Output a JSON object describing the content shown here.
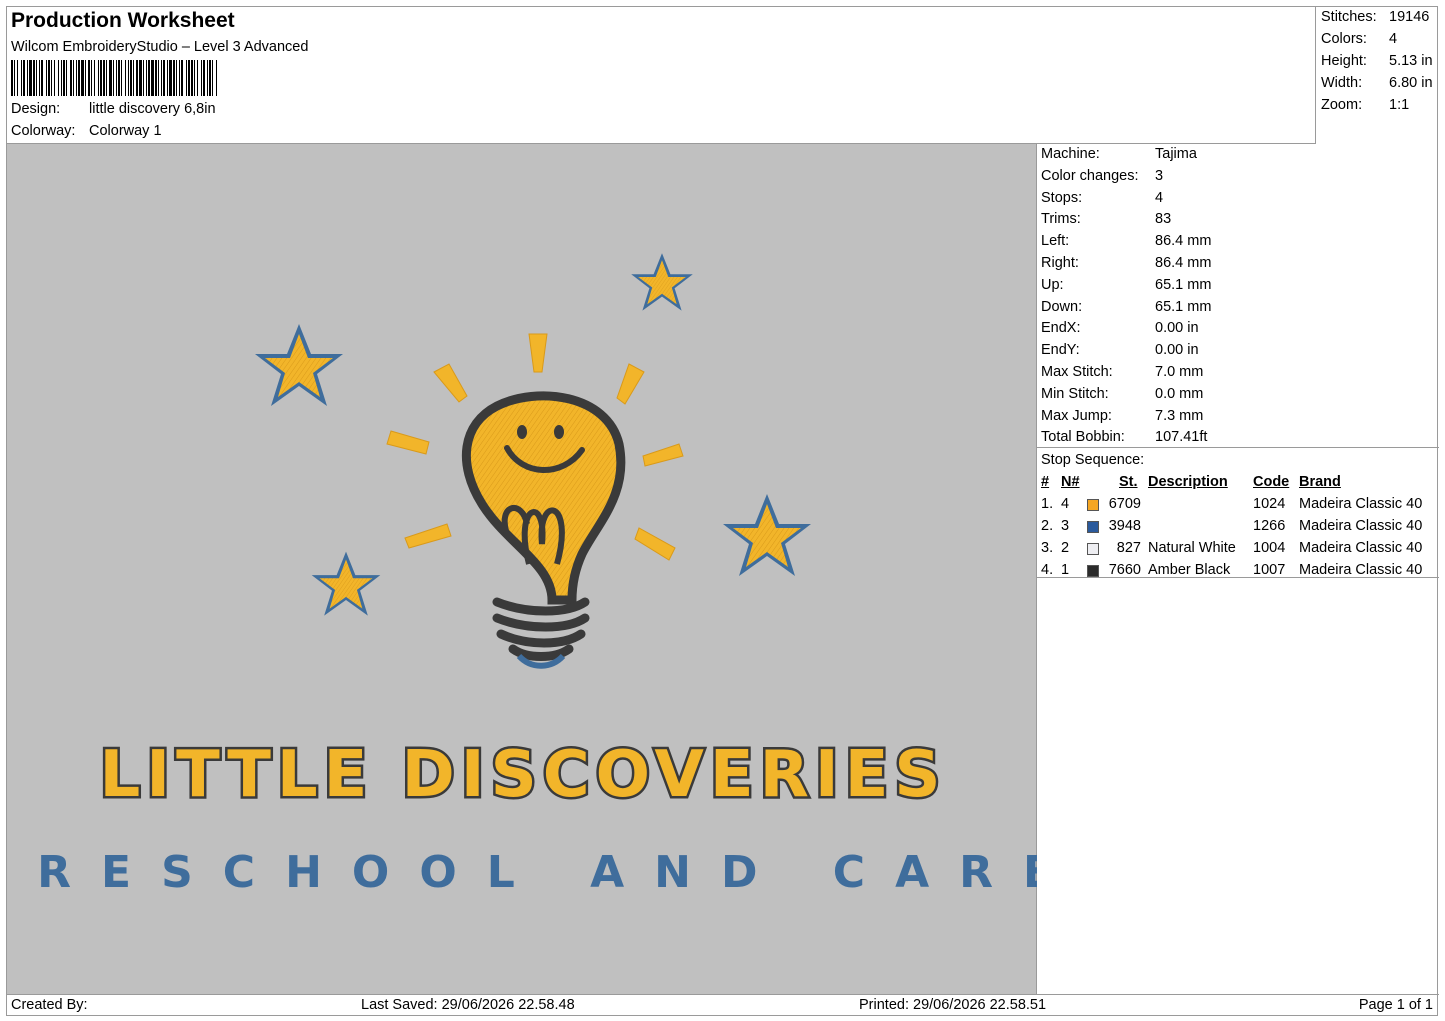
{
  "header": {
    "title": "Production Worksheet",
    "software": "Wilcom EmbroideryStudio – Level 3 Advanced",
    "design_label": "Design:",
    "design_value": "little discovery 6,8in",
    "colorway_label": "Colorway:",
    "colorway_value": "Colorway 1"
  },
  "stats": [
    {
      "label": "Stitches:",
      "value": "19146"
    },
    {
      "label": "Colors:",
      "value": "4"
    },
    {
      "label": "Height:",
      "value": "5.13 in"
    },
    {
      "label": "Width:",
      "value": "6.80 in"
    },
    {
      "label": "Zoom:",
      "value": "1:1"
    }
  ],
  "machine_info": [
    {
      "label": "Machine:",
      "value": "Tajima"
    },
    {
      "label": "Color changes:",
      "value": "3"
    },
    {
      "label": "Stops:",
      "value": "4"
    },
    {
      "label": "Trims:",
      "value": "83"
    },
    {
      "label": "Left:",
      "value": "86.4 mm"
    },
    {
      "label": "Right:",
      "value": "86.4 mm"
    },
    {
      "label": "Up:",
      "value": "65.1 mm"
    },
    {
      "label": "Down:",
      "value": "65.1 mm"
    },
    {
      "label": "EndX:",
      "value": "0.00 in"
    },
    {
      "label": "EndY:",
      "value": "0.00 in"
    },
    {
      "label": "Max Stitch:",
      "value": "7.0 mm"
    },
    {
      "label": "Min Stitch:",
      "value": "0.0 mm"
    },
    {
      "label": "Max Jump:",
      "value": "7.3 mm"
    },
    {
      "label": "Total Bobbin:",
      "value": "107.41ft"
    }
  ],
  "stop_sequence": {
    "caption": "Stop Sequence:",
    "headers": {
      "num": "#",
      "n": "N#",
      "st": "St.",
      "desc": "Description",
      "code": "Code",
      "brand": "Brand"
    },
    "rows": [
      {
        "num": "1.",
        "n": "4",
        "color": "#f5a623",
        "st": "6709",
        "desc": "",
        "code": "1024",
        "brand": "Madeira Classic 40"
      },
      {
        "num": "2.",
        "n": "3",
        "color": "#2a5a9c",
        "st": "3948",
        "desc": "",
        "code": "1266",
        "brand": "Madeira Classic 40"
      },
      {
        "num": "3.",
        "n": "2",
        "color": "#eeeef2",
        "st": "827",
        "desc": "Natural White",
        "code": "1004",
        "brand": "Madeira Classic 40"
      },
      {
        "num": "4.",
        "n": "1",
        "color": "#2b2b2b",
        "st": "7660",
        "desc": "Amber Black",
        "code": "1007",
        "brand": "Madeira Classic 40"
      }
    ]
  },
  "artwork": {
    "line1": "LITTLE DISCOVERIES",
    "line2": "PRESCHOOL AND CARE",
    "colors": {
      "gold": "#f2b52a",
      "blue": "#3f6d9c",
      "black": "#3a3a3a",
      "background": "#c0c0c0"
    }
  },
  "footer": {
    "created_by": "Created By:",
    "last_saved": "Last Saved: 29/06/2026 22.58.48",
    "printed": "Printed: 29/06/2026 22.58.51",
    "page": "Page 1 of 1"
  }
}
